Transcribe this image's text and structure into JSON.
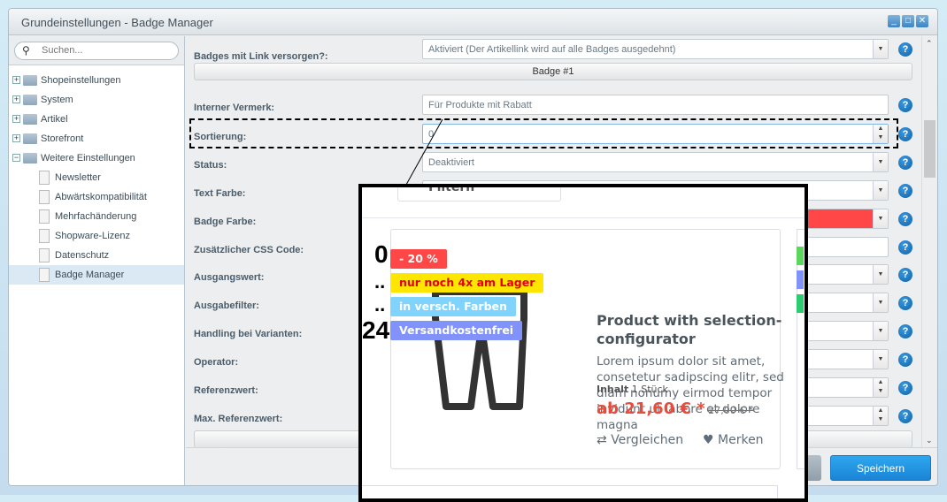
{
  "window": {
    "title": "Grundeinstellungen - Badge Manager",
    "buttons": [
      "minimize",
      "maximize",
      "close"
    ]
  },
  "sidebar": {
    "search_placeholder": "Suchen...",
    "items": [
      {
        "label": "Shopeinstellungen",
        "type": "folder",
        "expanded": false
      },
      {
        "label": "System",
        "type": "folder",
        "expanded": false
      },
      {
        "label": "Artikel",
        "type": "folder",
        "expanded": false
      },
      {
        "label": "Storefront",
        "type": "folder",
        "expanded": false
      },
      {
        "label": "Weitere Einstellungen",
        "type": "folder",
        "expanded": true
      },
      {
        "label": "Newsletter",
        "type": "doc"
      },
      {
        "label": "Abwärtskompatibilität",
        "type": "doc"
      },
      {
        "label": "Mehrfachänderung",
        "type": "doc"
      },
      {
        "label": "Shopware-Lizenz",
        "type": "doc"
      },
      {
        "label": "Datenschutz",
        "type": "doc"
      },
      {
        "label": "Badge Manager",
        "type": "doc",
        "selected": true
      }
    ]
  },
  "form": {
    "link_label": "Badges mit Link versorgen?:",
    "link_value": "Aktiviert (Der Artikellink wird auf alle Badges ausgedehnt)",
    "section_title": "Badge #1",
    "fields": [
      {
        "label": "Interner Vermerk:",
        "value": "Für Produkte mit Rabatt",
        "kind": "text"
      },
      {
        "label": "Sortierung:",
        "value": "0",
        "kind": "number"
      },
      {
        "label": "Status:",
        "value": "Deaktiviert",
        "kind": "select"
      },
      {
        "label": "Text Farbe:",
        "value": "#ffffff",
        "kind": "select"
      },
      {
        "label": "Badge Farbe:",
        "value": "",
        "kind": "color",
        "color": "#ff4747"
      },
      {
        "label": "Zusätzlicher CSS Code:",
        "value": "",
        "kind": "text"
      },
      {
        "label": "Ausgangswert:",
        "value": "",
        "kind": "select"
      },
      {
        "label": "Ausgabefilter:",
        "value": "",
        "kind": "select"
      },
      {
        "label": "Handling bei Varianten:",
        "value": "",
        "kind": "select"
      },
      {
        "label": "Operator:",
        "value": "",
        "kind": "select"
      },
      {
        "label": "Referenzwert:",
        "value": "",
        "kind": "number"
      },
      {
        "label": "Max. Referenzwert:",
        "value": "",
        "kind": "number"
      }
    ],
    "save_label": "Speichern"
  },
  "preview": {
    "sort_numbers": [
      "0",
      "..",
      "..",
      "24"
    ],
    "badges": [
      {
        "text": "- 20 %",
        "bg": "#ff4747",
        "color": "#ffffff"
      },
      {
        "text": "nur noch 4x am Lager",
        "bg": "#ffe600",
        "color": "#e3000f"
      },
      {
        "text": "in versch. Farben",
        "bg": "#7fd3fd",
        "color": "#ffffff"
      },
      {
        "text": "Versandkostenfrei",
        "bg": "#8193fb",
        "color": "#ffffff"
      }
    ],
    "product_title": "Product with selection-configurator",
    "description": "Lorem ipsum dolor sit amet, consetetur sadipscing elitr, sed diam nonumy eirmod tempor invidunt ut labore et dolore magna",
    "content_label": "Inhalt",
    "content_value": "1 Stück",
    "price": "ab 21,60 € *",
    "old_price": "27,00 € *",
    "compare_label": "Vergleichen",
    "wishlist_label": "Merken"
  }
}
